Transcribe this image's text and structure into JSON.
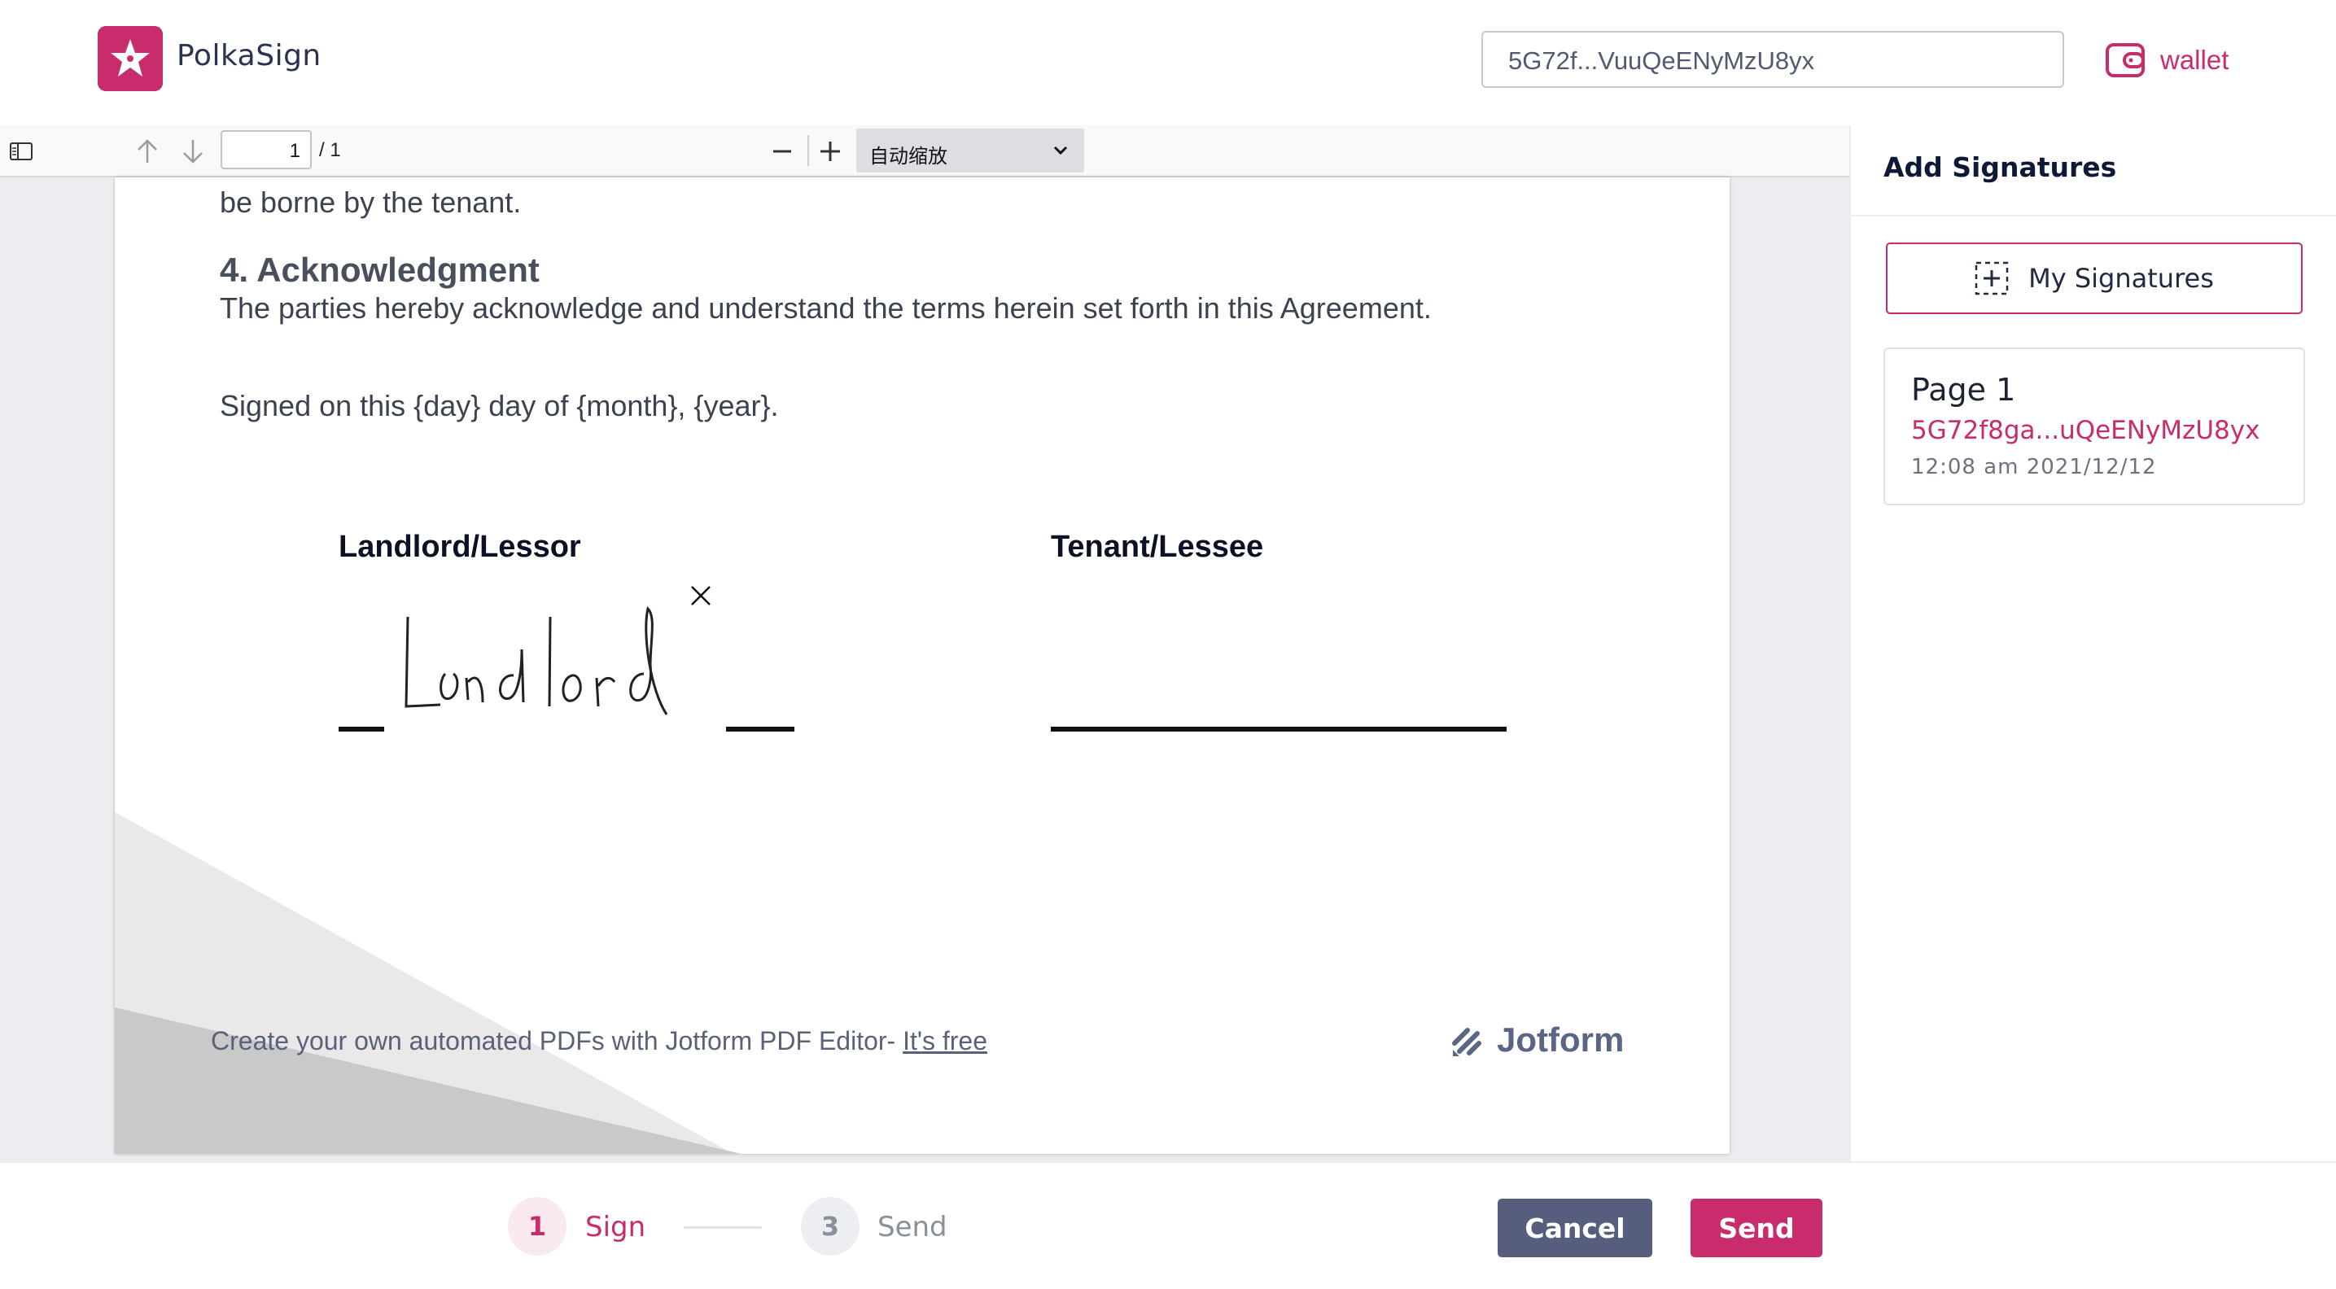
{
  "header": {
    "brand": "PolkaSign",
    "address": "5G72f...VuuQeENyMzU8yx",
    "wallet_label": "wallet"
  },
  "toolbar": {
    "page_number": "1",
    "page_total": "/ 1",
    "zoom": "自动缩放"
  },
  "document": {
    "partial_line": "be borne by the tenant.",
    "section_heading": "4. Acknowledgment",
    "section_body": "The parties hereby acknowledge and understand the terms herein set forth in this Agreement.",
    "signed_line": "Signed on this {day} day of {month}, {year}.",
    "landlord_label": "Landlord/Lessor",
    "tenant_label": "Tenant/Lessee",
    "landlord_signature": "Landlord",
    "footer_text": "Create your own automated PDFs with Jotform PDF Editor- ",
    "footer_link": "It's free",
    "footer_brand": "Jotform"
  },
  "panel": {
    "title": "Add Signatures",
    "my_signatures": "My Signatures",
    "card": {
      "page": "Page 1",
      "address": "5G72f8ga...uQeENyMzU8yx",
      "time": "12:08 am 2021/12/12"
    }
  },
  "steps": [
    {
      "number": "1",
      "label": "Sign"
    },
    {
      "number": "3",
      "label": "Send"
    }
  ],
  "actions": {
    "cancel": "Cancel",
    "send": "Send"
  },
  "colors": {
    "accent": "#c92c6d",
    "cancel_bg": "#575e7d",
    "step_active_bg": "#fbe9f0",
    "step_inactive_bg": "#eceef2"
  },
  "icons": [
    "star-icon",
    "wallet-icon",
    "sidebar-toggle-icon",
    "arrow-up-icon",
    "arrow-down-icon",
    "minus-icon",
    "plus-icon",
    "chevron-down-icon",
    "close-icon",
    "add-signature-icon",
    "jotform-logo-icon"
  ]
}
